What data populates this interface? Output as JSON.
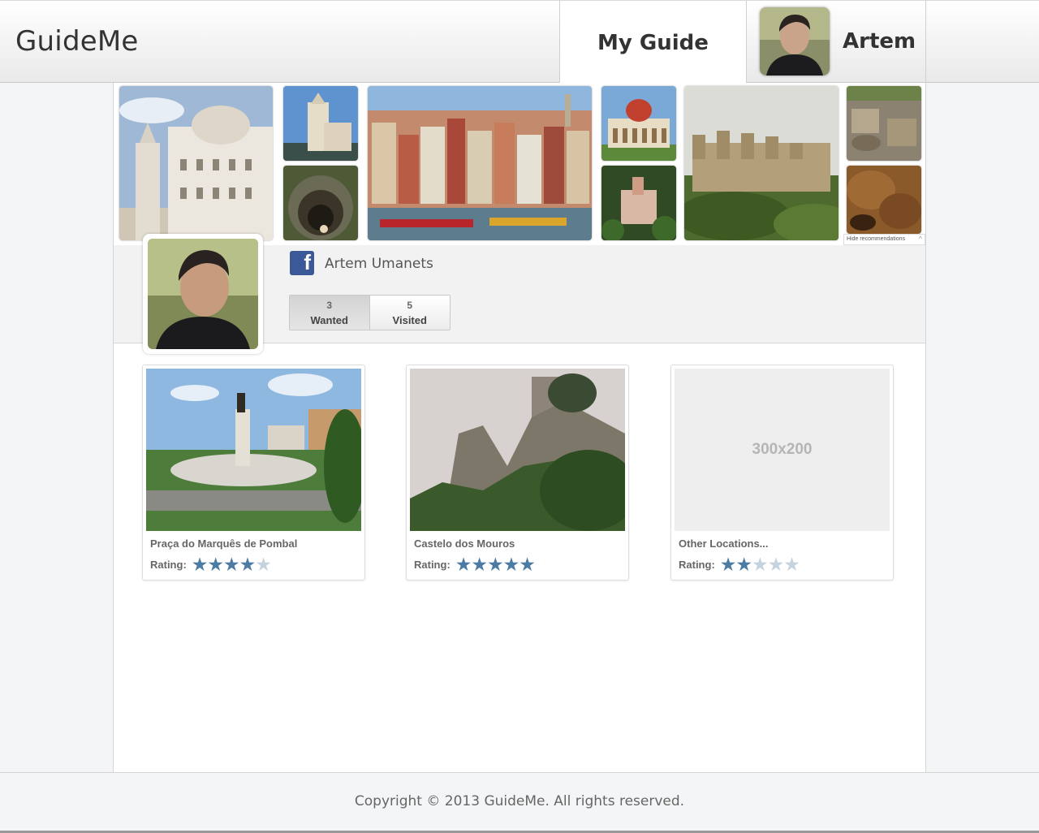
{
  "header": {
    "brand": "GuideMe",
    "nav_my_guide": "My Guide",
    "user_name": "Artem"
  },
  "recommendations": {
    "photos": [
      {
        "name": "palace-facade",
        "icon": "landmark-photo"
      },
      {
        "name": "belem-tower",
        "icon": "tower-photo"
      },
      {
        "name": "initiation-well",
        "icon": "well-photo"
      },
      {
        "name": "porto-riverside",
        "icon": "city-photo"
      },
      {
        "name": "monserrate-palace",
        "icon": "palace-photo"
      },
      {
        "name": "pena-palace",
        "icon": "palace-photo"
      },
      {
        "name": "obidos-castle",
        "icon": "castle-photo"
      },
      {
        "name": "roman-ruins",
        "icon": "ruins-photo"
      },
      {
        "name": "cork-texture",
        "icon": "texture-photo"
      }
    ],
    "hide_label": "Hide recommendations"
  },
  "profile": {
    "full_name": "Artem Umanets",
    "stats": [
      {
        "count": "3",
        "label": "Wanted",
        "active": true
      },
      {
        "count": "5",
        "label": "Visited",
        "active": false
      }
    ]
  },
  "cards": [
    {
      "title": "Praça do Marquês de Pombal",
      "rating_label": "Rating:",
      "rating": 4,
      "max_rating": 5
    },
    {
      "title": "Castelo dos Mouros",
      "rating_label": "Rating:",
      "rating": 5,
      "max_rating": 5
    },
    {
      "title": "Other Locations...",
      "rating_label": "Rating:",
      "rating": 2,
      "max_rating": 5,
      "placeholder": "300x200"
    }
  ],
  "footer": {
    "copyright": "Copyright © 2013 GuideMe. All rights reserved."
  },
  "colors": {
    "star_on": "#4d7ba3",
    "star_off": "#c5d3df",
    "facebook": "#3b5998"
  }
}
